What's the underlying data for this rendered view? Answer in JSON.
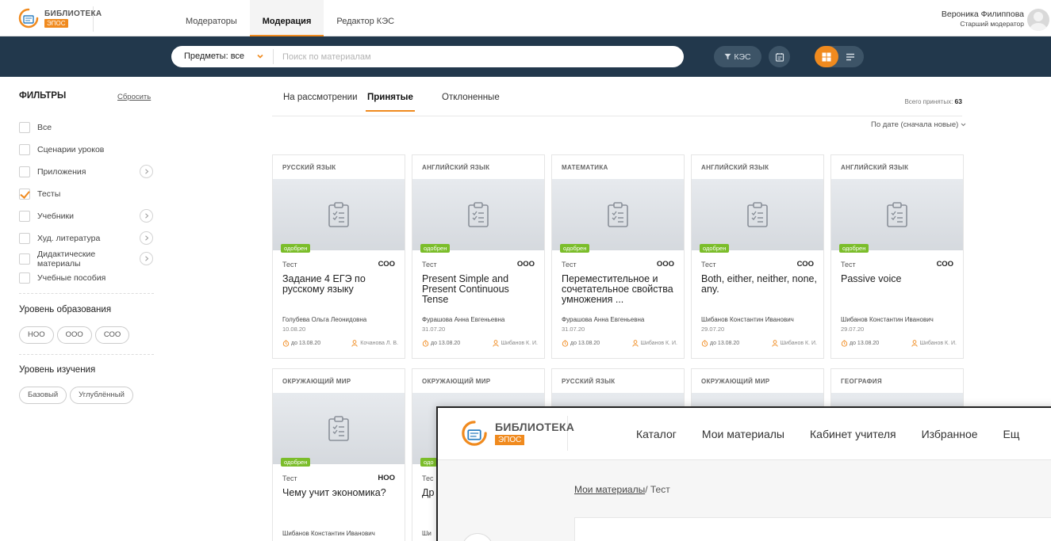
{
  "header": {
    "logo_title": "БИБЛИОТЕКА",
    "logo_badge": "ЭПОС",
    "tabs": [
      {
        "label": "Модераторы"
      },
      {
        "label": "Модерация"
      },
      {
        "label": "Редактор КЭС"
      }
    ],
    "active_tab": "Модерация",
    "user_name": "Вероника Филиппова",
    "user_role": "Старший модератор"
  },
  "search": {
    "subject_select": "Предметы: все",
    "placeholder": "Поиск по материалам",
    "kes_label": "КЭС"
  },
  "colors": {
    "accent": "#f08a1e",
    "search_bar": "#22384c",
    "approved_badge": "#7bbd2a"
  },
  "filters": {
    "title": "ФИЛЬТРЫ",
    "reset": "Сбросить",
    "items": [
      {
        "label": "Все",
        "checked": false,
        "expandable": false
      },
      {
        "label": "Сценарии уроков",
        "checked": false,
        "expandable": false
      },
      {
        "label": "Приложения",
        "checked": false,
        "expandable": true
      },
      {
        "label": "Тесты",
        "checked": true,
        "expandable": false
      },
      {
        "label": "Учебники",
        "checked": false,
        "expandable": true
      },
      {
        "label": "Худ. литература",
        "checked": false,
        "expandable": true
      },
      {
        "label": "Дидактические материалы",
        "checked": false,
        "expandable": true
      },
      {
        "label": "Учебные пособия",
        "checked": false,
        "expandable": false
      }
    ],
    "education_level": {
      "title": "Уровень образования",
      "options": [
        "НОО",
        "ООО",
        "СОО"
      ]
    },
    "study_level": {
      "title": "Уровень изучения",
      "options": [
        "Базовый",
        "Углублённый"
      ]
    }
  },
  "content": {
    "tabs": [
      "На рассмотрении",
      "Принятые",
      "Отклоненные"
    ],
    "active_tab": "Принятые",
    "total_label": "Всего принятых:",
    "total_value": "63",
    "sort_label": "По дате (сначала новые)"
  },
  "cards": [
    {
      "subject": "Русский язык",
      "badge": "одобрен",
      "type": "Тест",
      "level": "СОО",
      "title": "Задание 4 ЕГЭ по русскому языку",
      "author": "Голубева Ольга Леонидовна",
      "date": "10.08.20",
      "deadline": "до 13.08.20",
      "moderator": "Кочанова Л. В."
    },
    {
      "subject": "Английский язык",
      "badge": "одобрен",
      "type": "Тест",
      "level": "ООО",
      "title": "Present Simple and Present Continuous Tense",
      "author": "Фурашова Анна Евгеньевна",
      "date": "31.07.20",
      "deadline": "до 13.08.20",
      "moderator": "Шибанов К. И."
    },
    {
      "subject": "Математика",
      "badge": "одобрен",
      "type": "Тест",
      "level": "ООО",
      "title": "Переместительное и сочетательное свойства умножения ...",
      "author": "Фурашова Анна Евгеньевна",
      "date": "31.07.20",
      "deadline": "до 13.08.20",
      "moderator": "Шибанов К. И."
    },
    {
      "subject": "Английский язык",
      "badge": "одобрен",
      "type": "Тест",
      "level": "СОО",
      "title": "Both, either, neither, none, any.",
      "author": "Шибанов Константин Иванович",
      "date": "29.07.20",
      "deadline": "до 13.08.20",
      "moderator": "Шибанов К. И."
    },
    {
      "subject": "Английский язык",
      "badge": "одобрен",
      "type": "Тест",
      "level": "СОО",
      "title": "Passive voice",
      "author": "Шибанов Константин Иванович",
      "date": "29.07.20",
      "deadline": "до 13.08.20",
      "moderator": "Шибанов К. И."
    },
    {
      "subject": "Окружающий мир",
      "badge": "одобрен",
      "type": "Тест",
      "level": "НОО",
      "title": "Чему учит экономика?",
      "author": "Шибанов Константин Иванович"
    },
    {
      "subject": "Окружающий мир",
      "badge": "одо",
      "type": "Тес",
      "title": "Др",
      "author": "Ши"
    },
    {
      "subject": "Русский язык"
    },
    {
      "subject": "Окружающий мир"
    },
    {
      "subject": "География"
    }
  ],
  "overlay": {
    "logo_title": "БИБЛИОТЕКА",
    "logo_badge": "ЭПОС",
    "nav": [
      "Каталог",
      "Мои материалы",
      "Кабинет учителя",
      "Избранное",
      "Ещ"
    ],
    "breadcrumb_link": "Мои материалы",
    "breadcrumb_current": "/ Тест"
  }
}
